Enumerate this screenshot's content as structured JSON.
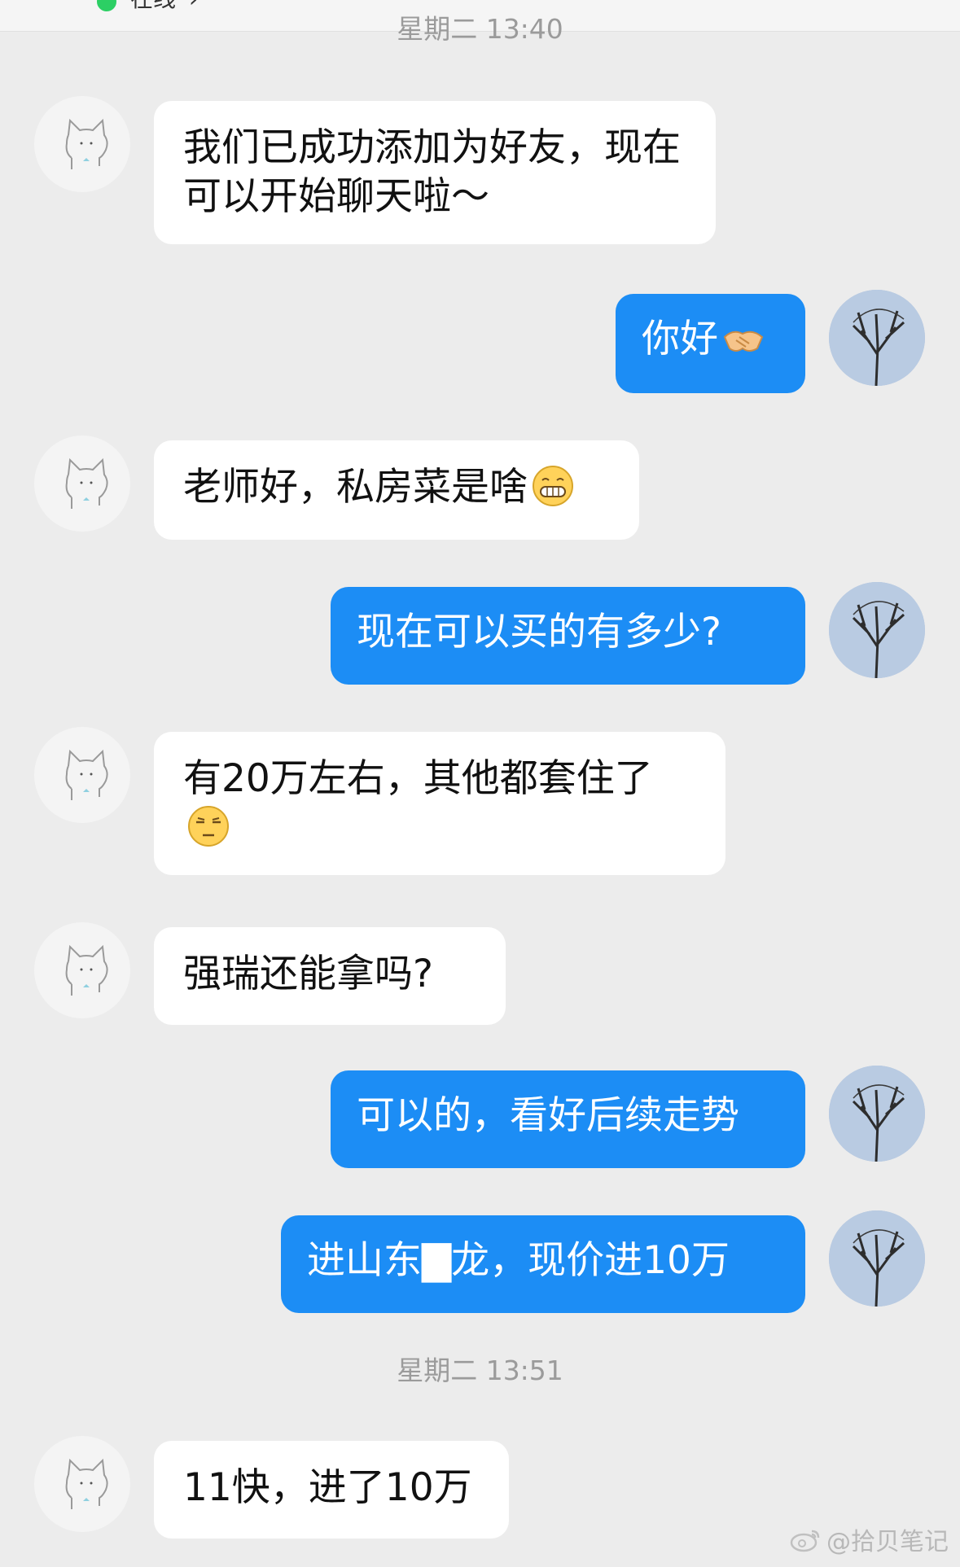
{
  "header": {
    "status": "在线",
    "chevron": "›"
  },
  "time_separators": {
    "first": "星期二 13:40",
    "second": "星期二 13:51"
  },
  "messages": [
    {
      "side": "in",
      "text": "我们已成功添加为好友，现在可以开始聊天啦～"
    },
    {
      "side": "out",
      "text": "你好",
      "emoji": "handshake"
    },
    {
      "side": "in",
      "text": "老师好，私房菜是啥",
      "emoji": "grin"
    },
    {
      "side": "out",
      "text": "现在可以买的有多少?"
    },
    {
      "side": "in",
      "text": "有20万左右，其他都套住了",
      "emoji": "unamused"
    },
    {
      "side": "in",
      "text": "强瑞还能拿吗?"
    },
    {
      "side": "out",
      "text": "可以的，看好后续走势"
    },
    {
      "side": "out",
      "text": "进山东▇龙，现价进10万"
    },
    {
      "side": "in",
      "text": "11快，进了10万"
    }
  ],
  "watermark": {
    "text": "@拾贝笔记",
    "icon": "weibo-icon"
  },
  "colors": {
    "out_bubble": "#1c8df5",
    "in_bubble": "#ffffff",
    "background": "#ececec",
    "online": "#2ccf64"
  }
}
